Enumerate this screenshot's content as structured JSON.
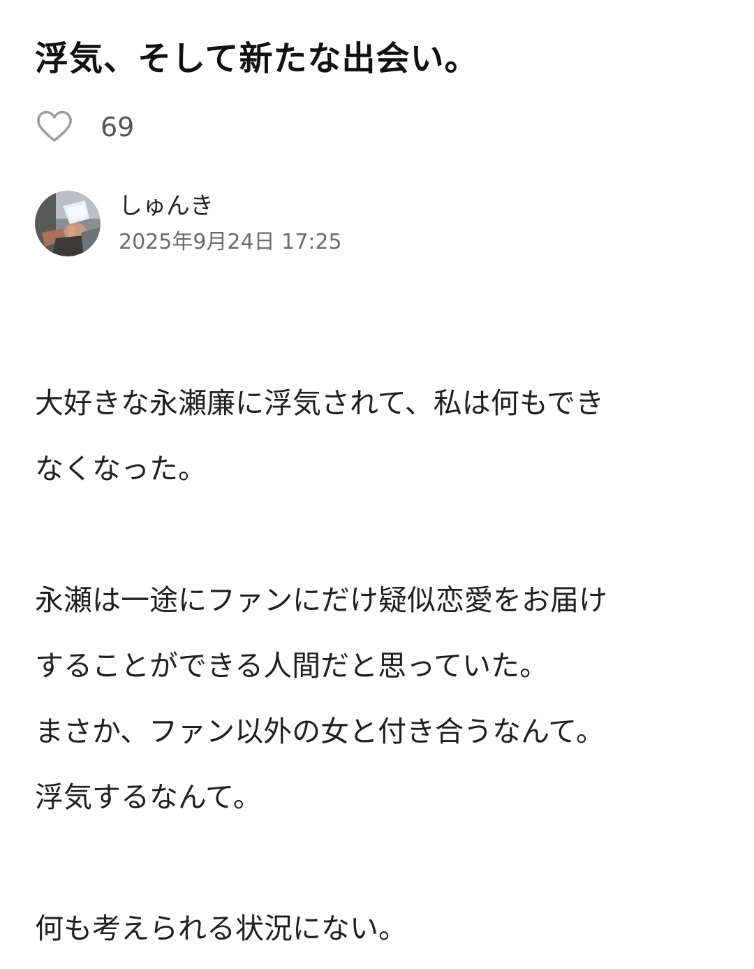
{
  "article": {
    "title": "浮気、そして新たな出会い。",
    "likes": {
      "icon": "heart-outline-icon",
      "count": "69"
    },
    "author": {
      "name": "しゅんき",
      "avatar_icon": "user-avatar-photo",
      "date": "2025年9月24日 17:25"
    },
    "paragraphs": [
      "大好きな永瀬廉に浮気されて、私は何もでき\nなくなった。",
      "永瀬は一途にファンにだけ疑似恋愛をお届け\nすることができる人間だと思っていた。\nまさか、ファン以外の女と付き合うなんて。\n浮気するなんて。",
      "何も考えられる状況にない。"
    ]
  },
  "colors": {
    "background": "#ffffff",
    "title": "#111111",
    "text": "#1f1f1f",
    "muted": "#6b6b6b",
    "icon": "#9e9e9e"
  }
}
